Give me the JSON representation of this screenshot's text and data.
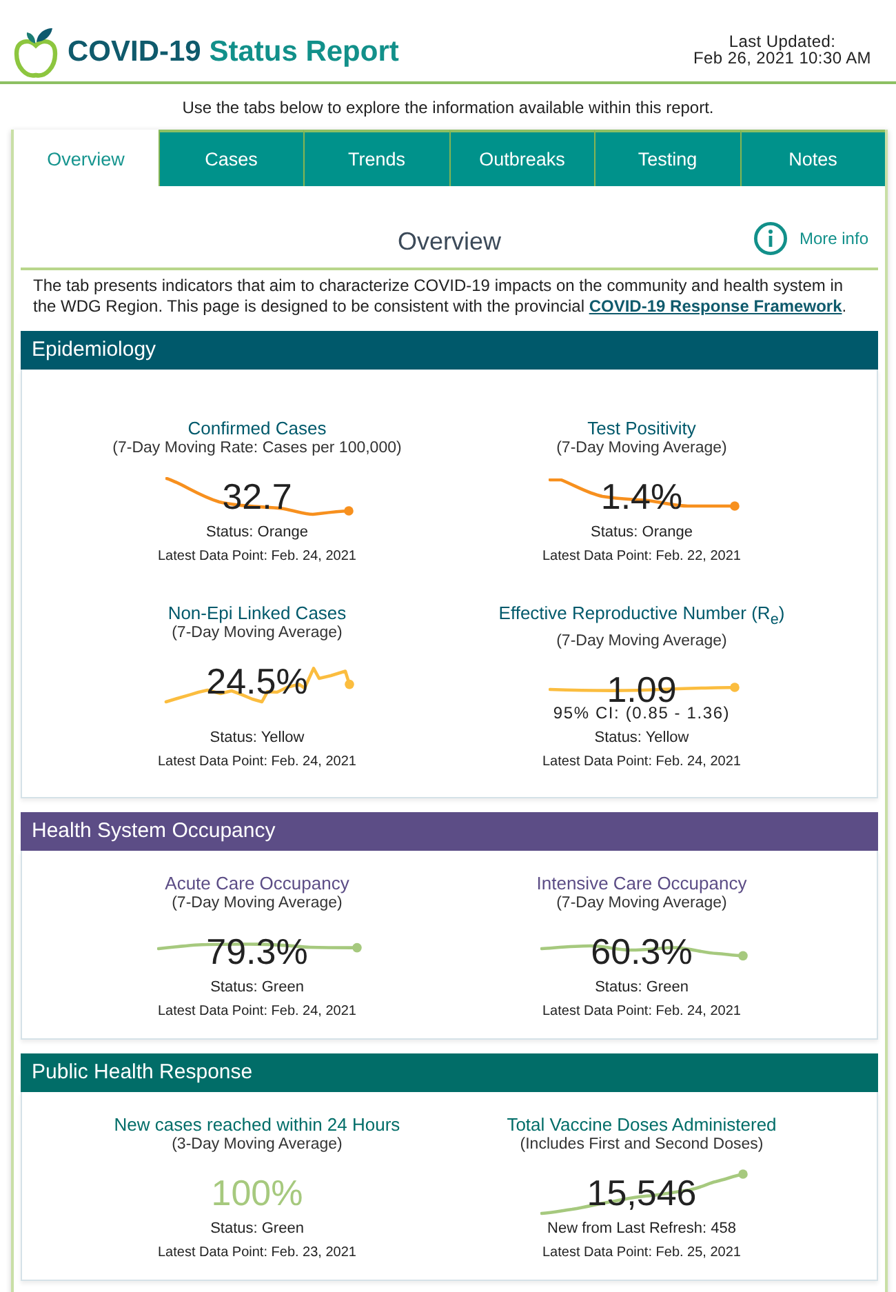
{
  "header": {
    "title_lead": "COVID-19",
    "title_rest": "Status Report",
    "updated_label": "Last Updated:",
    "updated_value": "Feb 26, 2021 10:30 AM"
  },
  "instructions": "Use the tabs below to explore the information available within this report.",
  "tabs": [
    {
      "label": "Overview",
      "selected": true
    },
    {
      "label": "Cases",
      "selected": false
    },
    {
      "label": "Trends",
      "selected": false
    },
    {
      "label": "Outbreaks",
      "selected": false
    },
    {
      "label": "Testing",
      "selected": false
    },
    {
      "label": "Notes",
      "selected": false
    }
  ],
  "overview": {
    "heading": "Overview",
    "more_info": "More info",
    "text": "The tab presents indicators that aim to characterize COVID-19 impacts on the community and health system in the WDG Region. This page is designed to be consistent with the provincial",
    "link": "COVID-19 Response Framework",
    "text_end": "."
  },
  "sections": [
    {
      "title": "Epidemiology",
      "color": "#00596b",
      "metrics": [
        {
          "title": "Confirmed Cases",
          "subtitle": "(7-Day Moving Rate: Cases per 100,000)",
          "kind": "trend",
          "color": "#f7901e",
          "value": "32.7",
          "status": "Status: Orange",
          "latest": "Latest Data Point: Feb. 24, 2021"
        },
        {
          "title": "Test Positivity",
          "subtitle": "(7-Day Moving Average)",
          "kind": "trend",
          "color": "#f7901e",
          "value": "1.4%",
          "status": "Status: Orange",
          "latest": "Latest Data Point: Feb. 22, 2021"
        },
        {
          "title": "Non-Epi Linked Cases",
          "subtitle": "(7-Day Moving Average)",
          "kind": "trend",
          "color": "#fbbd3f",
          "value": "24.5%",
          "status": "Status: Yellow",
          "latest": "Latest Data Point: Feb. 24, 2021"
        },
        {
          "title": "Effective Reproductive Number (R$_{e}$)",
          "subtitle": "(7-Day Moving Average)",
          "kind": "trend",
          "color": "#fbbd3f",
          "value": "1.09",
          "ci": "95% CI: (0.85 - 1.36)",
          "status": "Status: Yellow",
          "latest": "Latest Data Point: Feb. 24, 2021"
        }
      ]
    },
    {
      "title": "Health System Occupancy",
      "color": "#5c4d86",
      "metrics": [
        {
          "title": "Acute Care Occupancy",
          "subtitle": "(7-Day Moving Average)",
          "kind": "trend",
          "color": "#a6c97e",
          "value": "79.3%",
          "status": "Status: Green",
          "latest": "Latest Data Point: Feb. 24, 2021"
        },
        {
          "title": "Intensive Care Occupancy",
          "subtitle": "(7-Day Moving Average)",
          "kind": "trend",
          "color": "#a6c97e",
          "value": "60.3%",
          "status": "Status: Green",
          "latest": "Latest Data Point: Feb. 24, 2021"
        }
      ]
    },
    {
      "title": "Public Health Response",
      "color": "#016d68",
      "metrics": [
        {
          "title": "New cases reached within 24 Hours",
          "subtitle": "(3-Day Moving Average)",
          "kind": "plain",
          "color": "#a6c97e",
          "value": "100%",
          "status": "Status: Green",
          "latest": "Latest Data Point: Feb. 23, 2021"
        },
        {
          "title": "Total Vaccine Doses Administered",
          "subtitle": "(Includes First and Second Doses)",
          "kind": "trend",
          "color": "#a6c97e",
          "value": "15,546",
          "note": "New from Last Refresh: 458",
          "latest": "Latest Data Point: Feb. 25, 2021"
        }
      ]
    }
  ]
}
